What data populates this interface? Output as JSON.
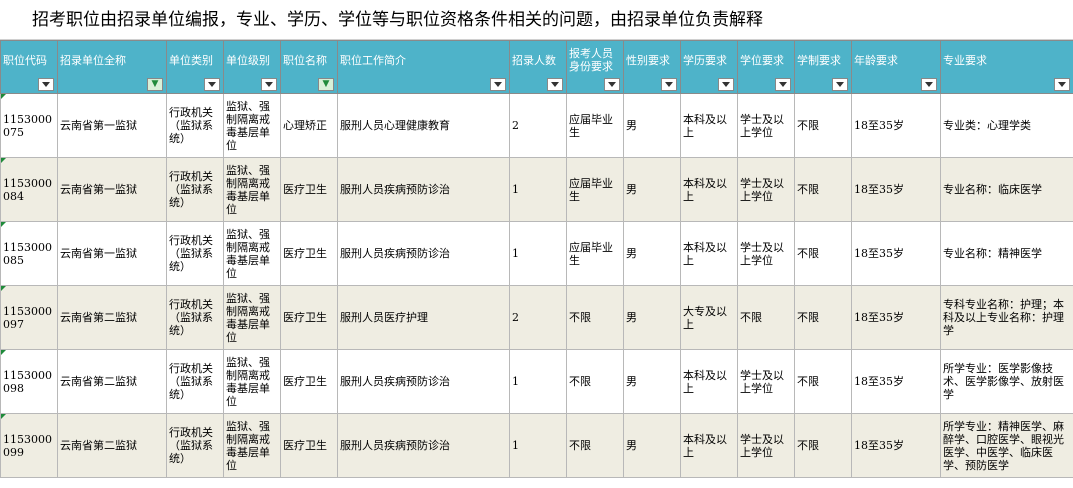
{
  "title": "招考职位由招录单位编报，专业、学历、学位等与职位资格条件相关的问题，由招录单位负责解释",
  "headers": [
    {
      "label": "职位代码",
      "filtered": false
    },
    {
      "label": "招录单位全称",
      "filtered": true
    },
    {
      "label": "单位类别",
      "filtered": false
    },
    {
      "label": "单位级别",
      "filtered": false
    },
    {
      "label": "职位名称",
      "filtered": true
    },
    {
      "label": "职位工作简介",
      "filtered": false
    },
    {
      "label": "招录人数",
      "filtered": false
    },
    {
      "label": "报考人员身份要求",
      "filtered": false
    },
    {
      "label": "性别要求",
      "filtered": false
    },
    {
      "label": "学历要求",
      "filtered": false
    },
    {
      "label": "学位要求",
      "filtered": false
    },
    {
      "label": "学制要求",
      "filtered": false
    },
    {
      "label": "年龄要求",
      "filtered": false
    },
    {
      "label": "专业要求",
      "filtered": false
    }
  ],
  "rows": [
    [
      "1153000075",
      "云南省第一监狱",
      "行政机关（监狱系统）",
      "监狱、强制隔离戒毒基层单位",
      "心理矫正",
      "服刑人员心理健康教育",
      "2",
      "应届毕业生",
      "男",
      "本科及以上",
      "学士及以上学位",
      "不限",
      "18至35岁",
      "专业类：心理学类"
    ],
    [
      "1153000084",
      "云南省第一监狱",
      "行政机关（监狱系统）",
      "监狱、强制隔离戒毒基层单位",
      "医疗卫生",
      "服刑人员疾病预防诊治",
      "1",
      "应届毕业生",
      "男",
      "本科及以上",
      "学士及以上学位",
      "不限",
      "18至35岁",
      "专业名称：临床医学"
    ],
    [
      "1153000085",
      "云南省第一监狱",
      "行政机关（监狱系统）",
      "监狱、强制隔离戒毒基层单位",
      "医疗卫生",
      "服刑人员疾病预防诊治",
      "1",
      "应届毕业生",
      "男",
      "本科及以上",
      "学士及以上学位",
      "不限",
      "18至35岁",
      "专业名称：精神医学"
    ],
    [
      "1153000097",
      "云南省第二监狱",
      "行政机关（监狱系统）",
      "监狱、强制隔离戒毒基层单位",
      "医疗卫生",
      "服刑人员医疗护理",
      "2",
      "不限",
      "男",
      "大专及以上",
      "不限",
      "不限",
      "18至35岁",
      "专科专业名称：护理；本科及以上专业名称：护理学"
    ],
    [
      "1153000098",
      "云南省第二监狱",
      "行政机关（监狱系统）",
      "监狱、强制隔离戒毒基层单位",
      "医疗卫生",
      "服刑人员疾病预防诊治",
      "1",
      "不限",
      "男",
      "本科及以上",
      "学士及以上学位",
      "不限",
      "18至35岁",
      "所学专业：医学影像技术、医学影像学、放射医学"
    ],
    [
      "1153000099",
      "云南省第二监狱",
      "行政机关（监狱系统）",
      "监狱、强制隔离戒毒基层单位",
      "医疗卫生",
      "服刑人员疾病预防诊治",
      "1",
      "不限",
      "男",
      "本科及以上",
      "学士及以上学位",
      "不限",
      "18至35岁",
      "所学专业：精神医学、麻醉学、口腔医学、眼视光医学、中医学、临床医学、预防医学"
    ]
  ]
}
